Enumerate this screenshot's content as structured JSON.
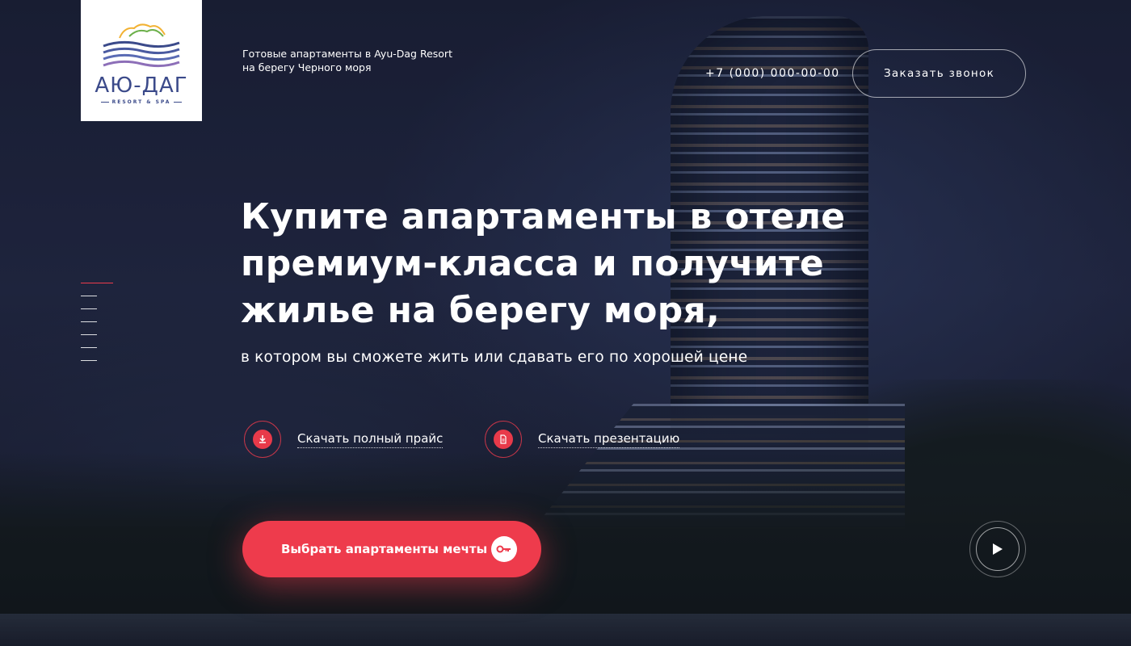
{
  "logo": {
    "name": "АЮ-ДАГ",
    "subtitle": "RESORT & SPA"
  },
  "header": {
    "tagline_line1": "Готовые апартаменты в Ayu-Dag Resort",
    "tagline_line2": "на берегу Черного моря",
    "phone": "+7 (000) 000-00-00",
    "callback_label": "Заказать звонок"
  },
  "hero": {
    "headline_line1": "Купите апартаменты в отеле",
    "headline_line2": "премиум-класса и получите",
    "headline_line3": "жилье на берегу моря,",
    "subheadline": "в котором вы сможете жить или сдавать его по хорошей цене"
  },
  "downloads": [
    {
      "label": "Скачать полный прайс",
      "icon": "download-icon"
    },
    {
      "label": "Скачать презентацию",
      "icon": "document-icon"
    }
  ],
  "cta": {
    "label": "Выбрать апартаменты мечты",
    "icon": "key-icon"
  },
  "side_nav": {
    "count": 7,
    "active_index": 0
  },
  "video": {
    "icon": "play-icon"
  },
  "colors": {
    "accent": "#ee3b4c",
    "logo_blue": "#3b4a8a",
    "background": "#1b2034"
  }
}
